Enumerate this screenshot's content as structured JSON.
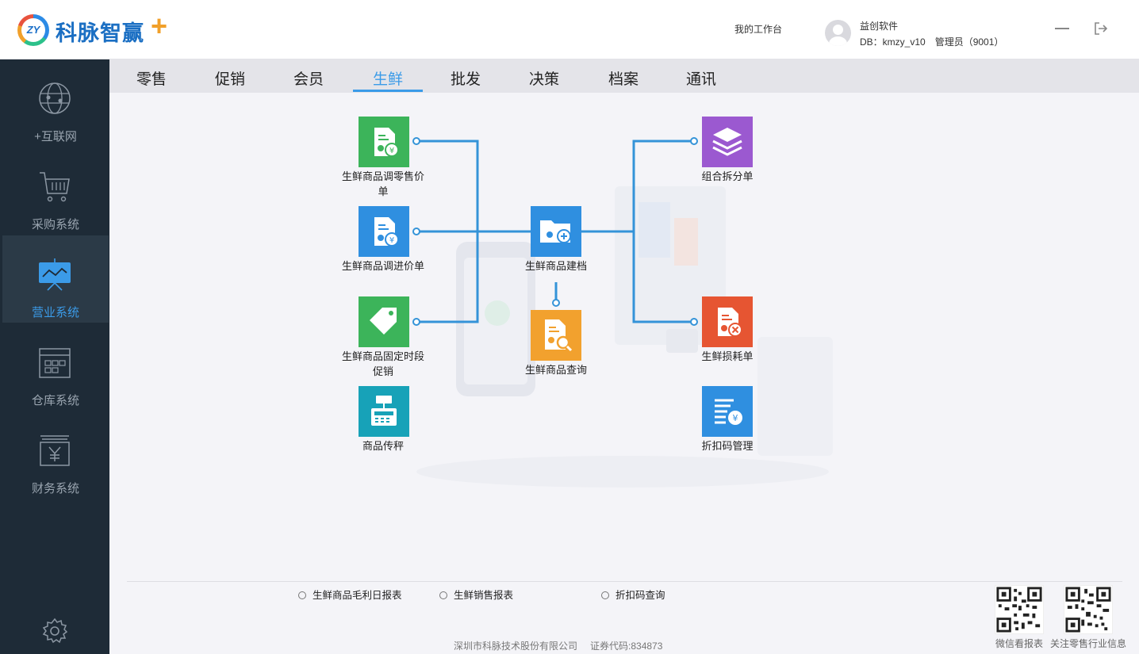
{
  "header": {
    "brand_name": "科脉智赢",
    "logo_mark": "ZY",
    "workbench": "我的工作台",
    "user_name": "益创软件",
    "db": "DB：kmzy_v10",
    "role": "管理员（9001）",
    "minimize_icon": "minimize-icon",
    "exit_icon": "logout-icon"
  },
  "sidebar": {
    "items": [
      {
        "label": "+互联网",
        "icon": "globe-icon"
      },
      {
        "label": "采购系统",
        "icon": "cart-icon"
      },
      {
        "label": "营业系统",
        "icon": "presentation-icon",
        "active": true
      },
      {
        "label": "仓库系统",
        "icon": "warehouse-icon"
      },
      {
        "label": "财务系统",
        "icon": "finance-icon"
      }
    ],
    "settings_icon": "gear-icon"
  },
  "tabs": [
    {
      "label": "零售"
    },
    {
      "label": "促销"
    },
    {
      "label": "会员"
    },
    {
      "label": "生鲜",
      "active": true
    },
    {
      "label": "批发"
    },
    {
      "label": "决策"
    },
    {
      "label": "档案"
    },
    {
      "label": "通讯"
    }
  ],
  "tiles": {
    "retail_price": {
      "label": "生鲜商品调零售价单",
      "color": "#3cb45a",
      "icon": "price-doc-icon"
    },
    "purchase_price": {
      "label": "生鲜商品调进价单",
      "color": "#2f8fe0",
      "icon": "purchase-doc-icon"
    },
    "fixed_promo": {
      "label": "生鲜商品固定时段促销",
      "color": "#3cb45a",
      "icon": "tag-icon"
    },
    "scale": {
      "label": "商品传秤",
      "color": "#17a2b8",
      "icon": "scale-icon"
    },
    "archive": {
      "label": "生鲜商品建档",
      "color": "#2f8fe0",
      "icon": "folder-add-icon"
    },
    "query": {
      "label": "生鲜商品查询",
      "color": "#f2a12e",
      "icon": "search-doc-icon"
    },
    "combo_split": {
      "label": "组合拆分单",
      "color": "#9b59d0",
      "icon": "layers-icon"
    },
    "loss": {
      "label": "生鲜损耗单",
      "color": "#e65532",
      "icon": "loss-doc-icon"
    },
    "discount_code": {
      "label": "折扣码管理",
      "color": "#2f8fe0",
      "icon": "discount-code-icon"
    }
  },
  "reports": [
    {
      "label": "生鲜商品毛利日报表"
    },
    {
      "label": "生鲜销售报表"
    },
    {
      "label": "折扣码查询"
    }
  ],
  "footer": {
    "company": "深圳市科脉技术股份有限公司",
    "stock_code": "证券代码:834873"
  },
  "qr": [
    {
      "label": "微信看报表"
    },
    {
      "label": "关注零售行业信息"
    }
  ]
}
